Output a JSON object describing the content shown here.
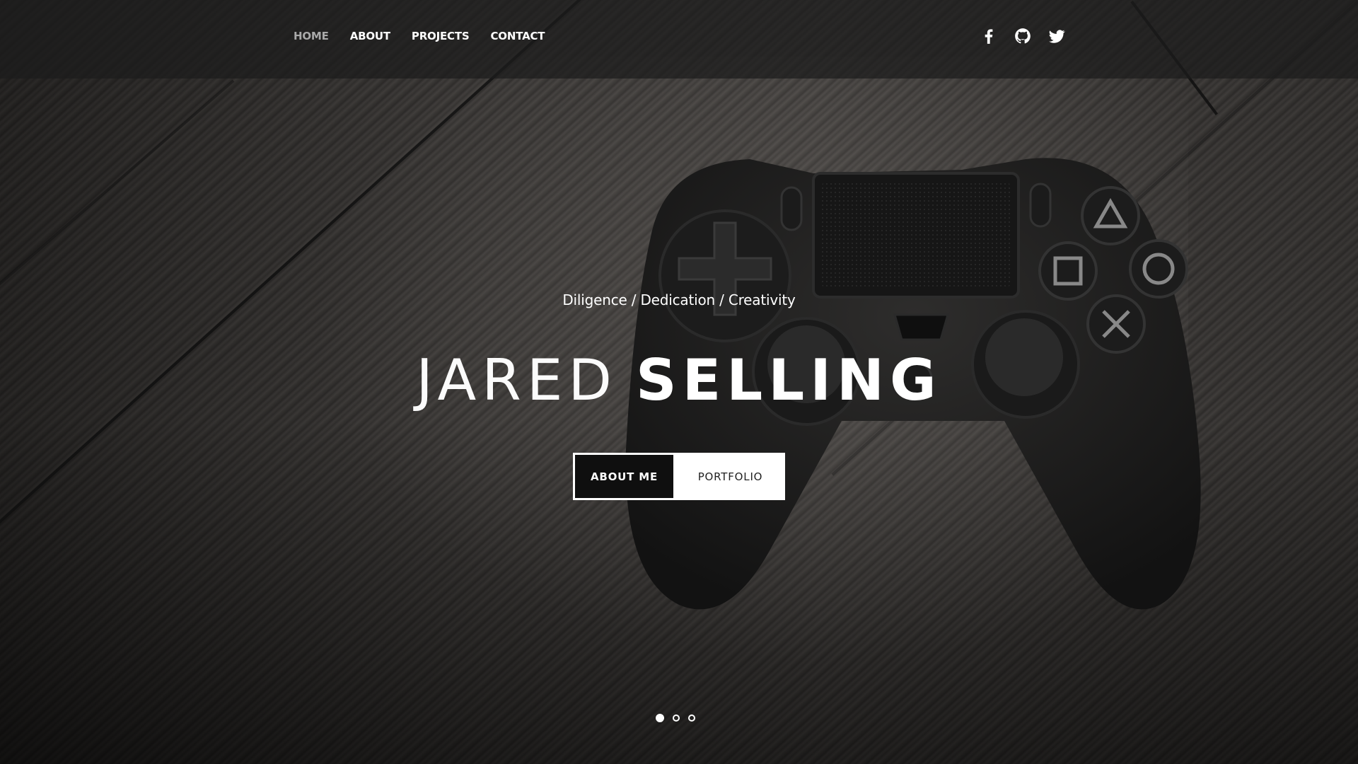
{
  "nav": {
    "items": [
      {
        "label": "HOME",
        "active": true
      },
      {
        "label": "ABOUT",
        "active": false
      },
      {
        "label": "PROJECTS",
        "active": false
      },
      {
        "label": "CONTACT",
        "active": false
      }
    ]
  },
  "social": {
    "icons": [
      "facebook-icon",
      "github-icon",
      "twitter-icon"
    ]
  },
  "hero": {
    "tagline": "Diligence / Dedication / Creativity",
    "name_first": "JARED",
    "name_last": "SELLING",
    "about_label": "ABOUT ME",
    "portfolio_label": "PORTFOLIO"
  },
  "carousel": {
    "slide_count": 3,
    "active_index": 0
  },
  "colors": {
    "text": "#ffffff",
    "nav_active": "#a9a9a9",
    "button_dark": "#0f0f0f",
    "button_light": "#ffffff"
  }
}
